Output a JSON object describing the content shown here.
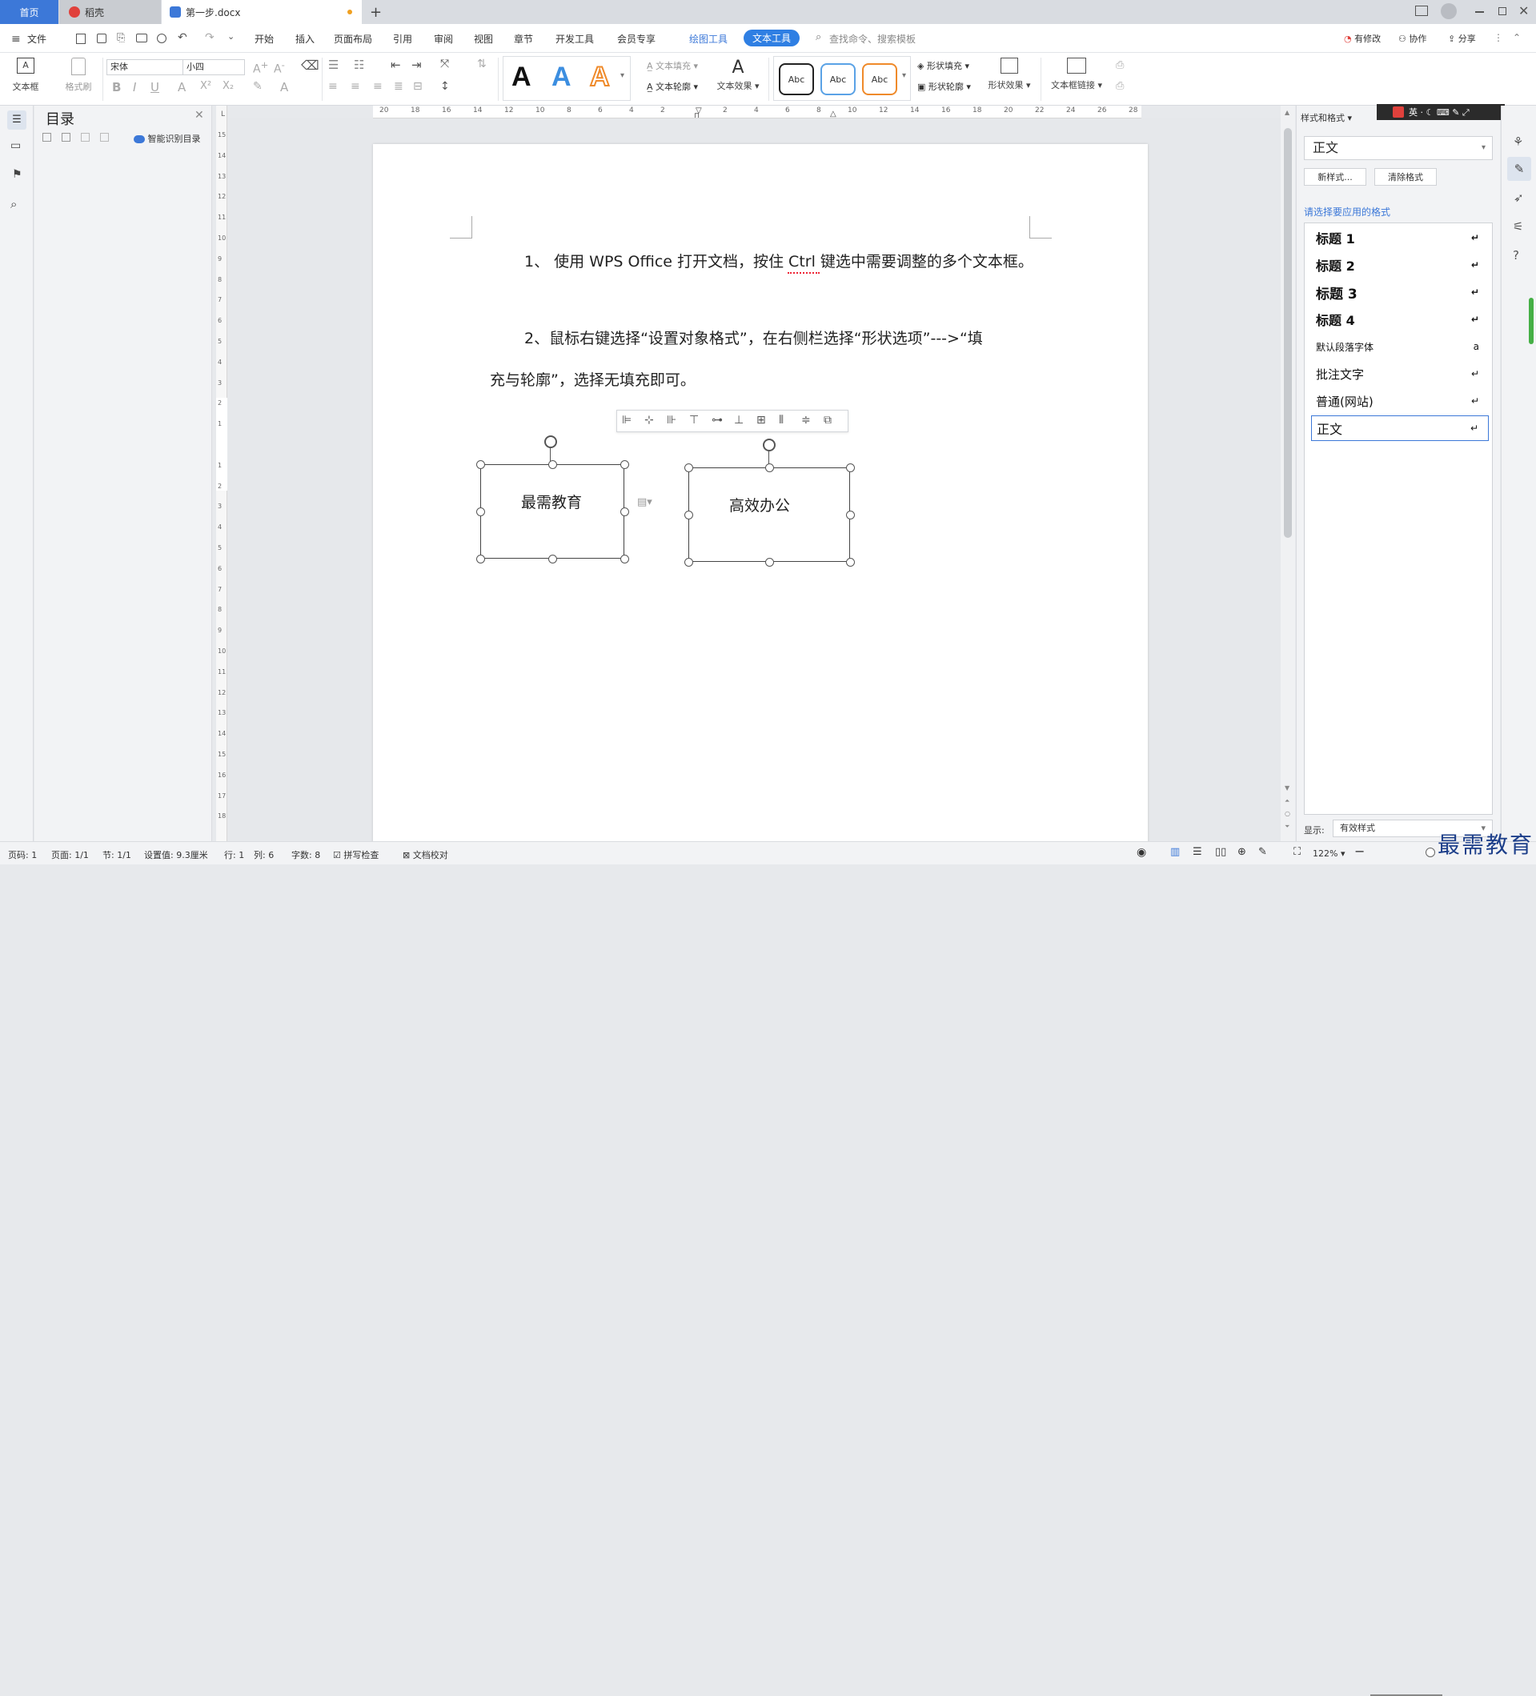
{
  "tabs": {
    "home": "首页",
    "daoke": "稻壳",
    "doc": "第一步.docx",
    "new_tab": "+"
  },
  "menubar": {
    "file": "文件",
    "items": [
      "开始",
      "插入",
      "页面布局",
      "引用",
      "审阅",
      "视图",
      "章节",
      "开发工具",
      "会员专享"
    ],
    "drawing_tools": "绘图工具",
    "text_tools": "文本工具",
    "search_placeholder": "查找命令、搜索模板",
    "modified": "有修改",
    "collaborate": "协作",
    "share": "分享"
  },
  "ribbon": {
    "textbox": "文本框",
    "format_painter": "格式刷",
    "font_name": "宋体",
    "font_size": "小四",
    "text_fill": "文本填充",
    "text_outline": "文本轮廓",
    "text_effect": "文本效果",
    "abc": "Abc",
    "shape_fill": "形状填充",
    "shape_outline": "形状轮廓",
    "shape_effect": "形状效果",
    "textbox_link": "文本框链接"
  },
  "toc": {
    "title": "目录",
    "smart": "智能识别目录"
  },
  "ruler": {
    "h_ticks": [
      "20",
      "18",
      "16",
      "14",
      "12",
      "10",
      "8",
      "6",
      "4",
      "2",
      "",
      "2",
      "4",
      "6",
      "8",
      "10",
      "12",
      "14",
      "16",
      "18",
      "20",
      "22",
      "24",
      "26",
      "28"
    ],
    "v_ticks": [
      "15",
      "14",
      "13",
      "12",
      "11",
      "10",
      "9",
      "8",
      "7",
      "6",
      "5",
      "4",
      "3",
      "2",
      "1",
      "",
      "1",
      "2",
      "3",
      "4",
      "5",
      "6",
      "7",
      "8",
      "9",
      "10",
      "11",
      "12",
      "13",
      "14",
      "15",
      "16",
      "17",
      "18"
    ]
  },
  "document": {
    "para1": "1、 使用 WPS Office 打开文档，按住 Ctrl 键选中需要调整的多个文本框。",
    "para2_line1": "2、鼠标右键选择“设置对象格式”，在右侧栏选择“形状选项”--->“填",
    "para2_line2": "充与轮廓”，选择无填充即可。",
    "textbox1": "最需教育",
    "textbox2": "高效办公"
  },
  "stylepanel": {
    "header": "样式和格式",
    "current": "正文",
    "new_style": "新样式...",
    "clear_format": "清除格式",
    "prompt": "请选择要应用的格式",
    "styles": [
      "标题 1",
      "标题 2",
      "标题 3",
      "标题 4",
      "默认段落字体",
      "批注文字",
      "普通(网站)",
      "正文"
    ],
    "show_label": "显示:",
    "show_value": "有效样式"
  },
  "statusbar": {
    "page_num": "页码: 1",
    "pages": "页面: 1/1",
    "section": "节: 1/1",
    "setting": "设置值: 9.3厘米",
    "row": "行: 1",
    "col": "列: 6",
    "words": "字数: 8",
    "spell": "拼写检查",
    "proof": "文档校对",
    "zoom": "122%"
  },
  "watermark": "最需教育",
  "colors": {
    "accent": "#3c78d8",
    "texttool_pill": "#2f7fe3"
  }
}
